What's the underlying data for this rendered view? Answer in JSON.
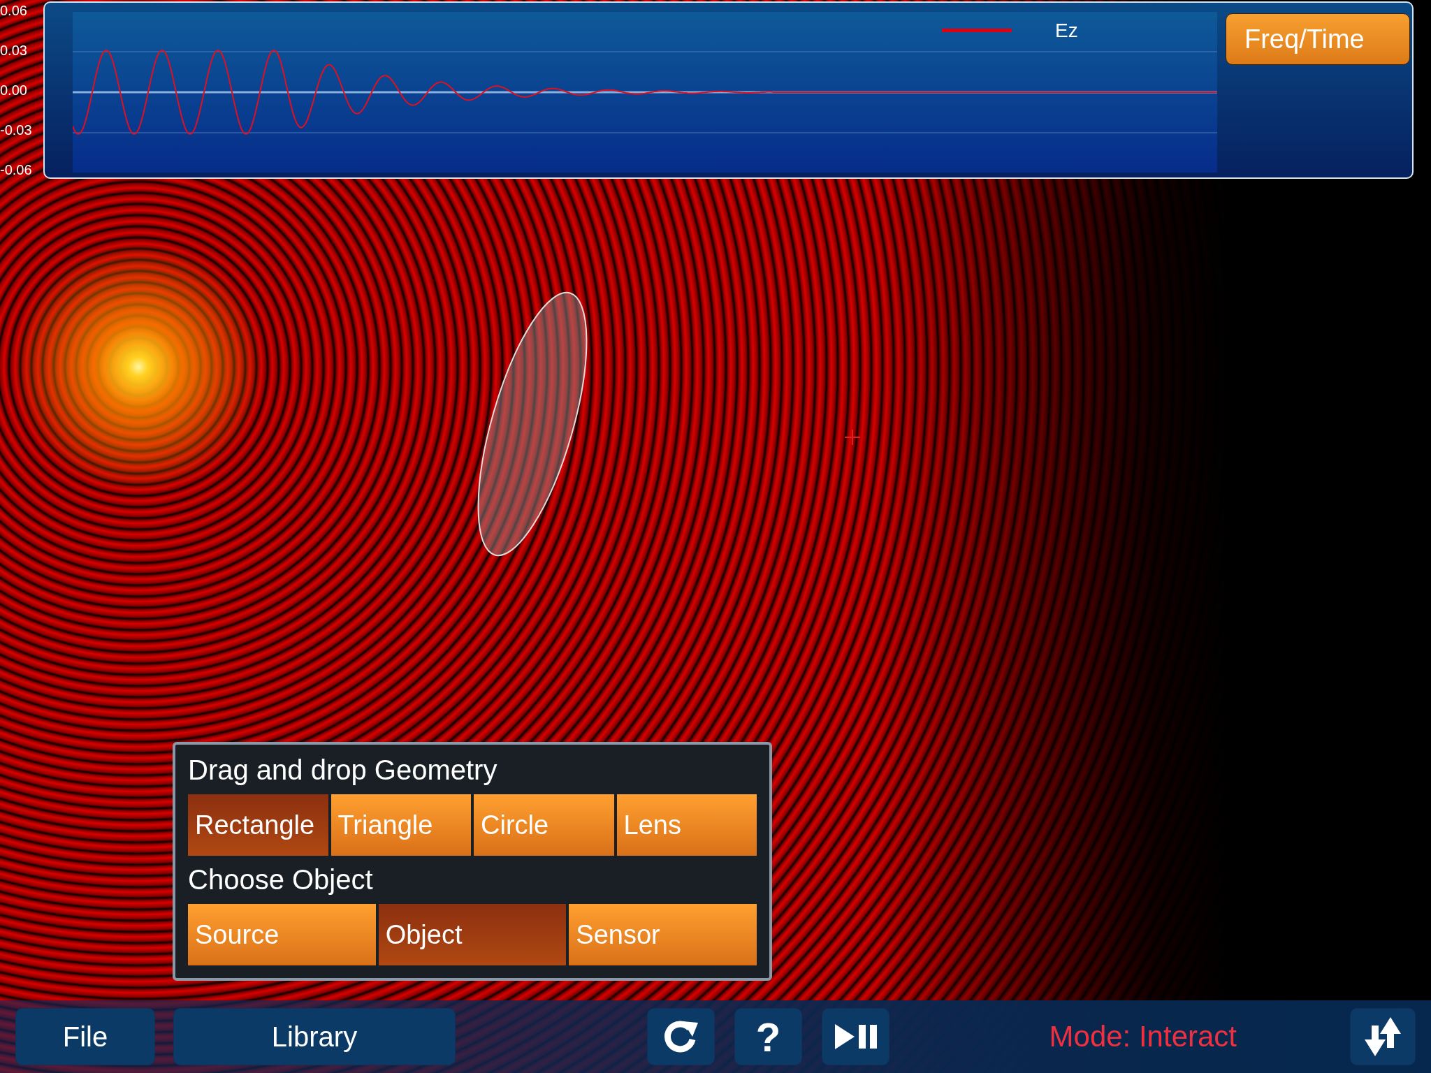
{
  "plot": {
    "y_axis_labels": [
      "0.06",
      "0.03",
      "0.00",
      "-0.03",
      "-0.06"
    ],
    "legend": "Ez",
    "toggle_button": "Freq/Time"
  },
  "geometry_panel": {
    "title": "Drag and drop Geometry",
    "shapes": [
      {
        "label": "Rectangle",
        "selected": true
      },
      {
        "label": "Triangle",
        "selected": false
      },
      {
        "label": "Circle",
        "selected": false
      },
      {
        "label": "Lens",
        "selected": false
      }
    ],
    "object_title": "Choose Object",
    "objects": [
      {
        "label": "Source",
        "selected": false
      },
      {
        "label": "Object",
        "selected": true
      },
      {
        "label": "Sensor",
        "selected": false
      }
    ]
  },
  "bottom_bar": {
    "file_button": "File",
    "library_button": "Library",
    "tools": [
      {
        "kind": "refresh"
      },
      {
        "kind": "help",
        "label": "?"
      },
      {
        "kind": "play-pause"
      }
    ],
    "mode": "Mode: Interact"
  }
}
